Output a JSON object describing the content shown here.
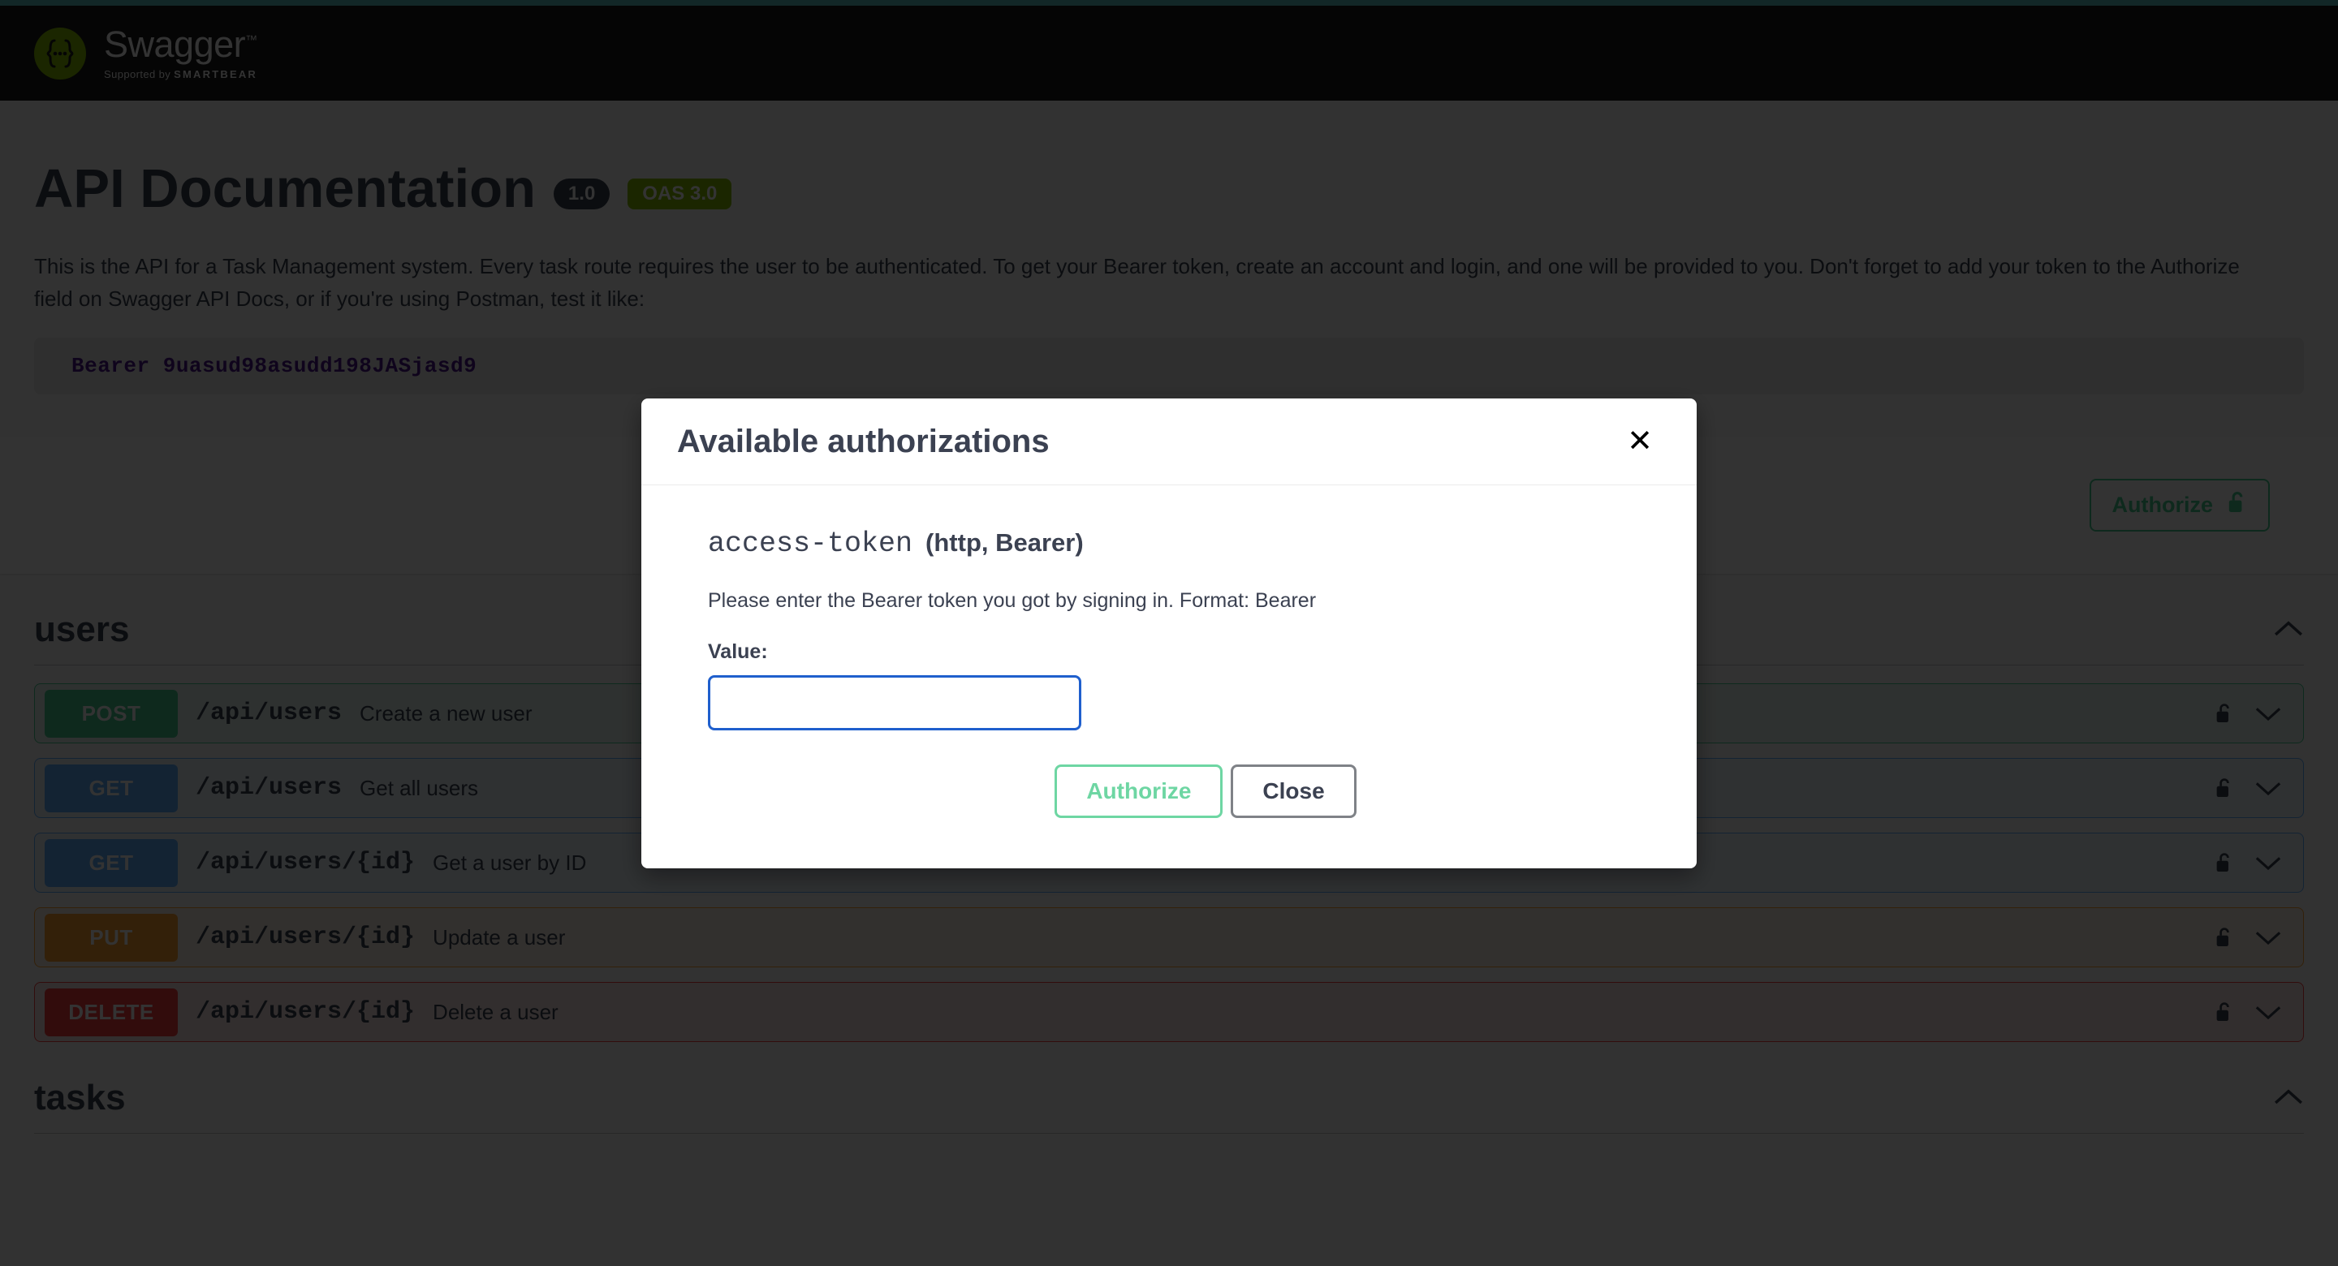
{
  "topbar": {
    "logo_icon": "swagger-braces-logo",
    "brand": "Swagger",
    "trademark": "™",
    "supported_by_prefix": "Supported by ",
    "supported_by_brand": "SMARTBEAR"
  },
  "info": {
    "title": "API Documentation",
    "version_badge": "1.0",
    "oas_badge": "OAS 3.0",
    "description": "This is the API for a Task Management system. Every task route requires the user to be authenticated. To get your Bearer token, create an account and login, and one will be provided to you. Don't forget to add your token to the Authorize field on Swagger API Docs, or if you're using Postman, test it like:",
    "code_sample": "Bearer 9uasud98asudd198JASjasd9"
  },
  "scheme_bar": {
    "authorize_label": "Authorize",
    "lock_icon": "unlocked-padlock-icon"
  },
  "tags": [
    {
      "name": "users",
      "collapse_icon": "chevron-up-icon",
      "operations": [
        {
          "method": "POST",
          "path": "/api/users",
          "summary": "Create a new user",
          "lock_icon": "unlocked-padlock-icon",
          "expand_icon": "chevron-down-icon"
        },
        {
          "method": "GET",
          "path": "/api/users",
          "summary": "Get all users",
          "lock_icon": "unlocked-padlock-icon",
          "expand_icon": "chevron-down-icon"
        },
        {
          "method": "GET",
          "path": "/api/users/{id}",
          "summary": "Get a user by ID",
          "lock_icon": "unlocked-padlock-icon",
          "expand_icon": "chevron-down-icon"
        },
        {
          "method": "PUT",
          "path": "/api/users/{id}",
          "summary": "Update a user",
          "lock_icon": "unlocked-padlock-icon",
          "expand_icon": "chevron-down-icon"
        },
        {
          "method": "DELETE",
          "path": "/api/users/{id}",
          "summary": "Delete a user",
          "lock_icon": "unlocked-padlock-icon",
          "expand_icon": "chevron-down-icon"
        }
      ]
    },
    {
      "name": "tasks",
      "collapse_icon": "chevron-up-icon",
      "operations": []
    }
  ],
  "modal": {
    "title": "Available authorizations",
    "close_icon": "close-x-icon",
    "scheme_name": "access-token",
    "scheme_type": "(http, Bearer)",
    "scheme_description": "Please enter the Bearer token you got by signing in. Format: Bearer",
    "value_label": "Value:",
    "input_value": "",
    "input_placeholder": "",
    "authorize_label": "Authorize",
    "close_label": "Close"
  },
  "colors": {
    "accent_bar": "#5bc0c0",
    "topbar_bg": "#1b1b1b",
    "brand_green": "#89bf04",
    "post": "#49cc90",
    "get": "#61affe",
    "put": "#fca130",
    "delete": "#f93e3e",
    "text": "#3b4151",
    "code_text": "#4a148c",
    "input_focus_border": "#1f5fcd",
    "modal_authorize_green": "#6ed6a3",
    "modal_close_gray": "#7f8287"
  }
}
